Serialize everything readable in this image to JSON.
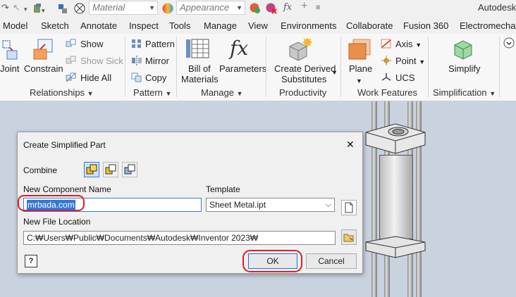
{
  "app": {
    "name": "Autodesk"
  },
  "quick_access": {
    "material_value": "Material",
    "appearance_value": "Appearance"
  },
  "tabs": [
    "Model",
    "Sketch",
    "Annotate",
    "Inspect",
    "Tools",
    "Manage",
    "View",
    "Environments",
    "Collaborate",
    "Fusion 360",
    "Electromechan"
  ],
  "ribbon": {
    "relationships": {
      "joint": "Joint",
      "constrain": "Constrain",
      "show": "Show",
      "show_sick": "Show Sick",
      "hide_all": "Hide All",
      "group": "Relationships"
    },
    "pattern": {
      "pattern": "Pattern",
      "mirror": "Mirror",
      "copy": "Copy",
      "group": "Pattern"
    },
    "manage": {
      "bom_line1": "Bill of",
      "bom_line2": "Materials",
      "parameters": "Parameters",
      "group": "Manage"
    },
    "productivity": {
      "line1": "Create Derived",
      "line2": "Substitutes",
      "group": "Productivity"
    },
    "work_features": {
      "plane": "Plane",
      "axis": "Axis",
      "point": "Point",
      "ucs": "UCS",
      "group": "Work Features"
    },
    "simplification": {
      "simplify": "Simplify",
      "group": "Simplification"
    }
  },
  "dialog": {
    "title": "Create Simplified Part",
    "combine_label": "Combine",
    "component_name_label": "New Component Name",
    "component_name_value": "mrbada.com",
    "template_label": "Template",
    "template_value": "Sheet Metal.ipt",
    "file_location_label": "New File Location",
    "file_location_value": "C:₩Users₩Public₩Documents₩Autodesk₩Inventor 2023₩",
    "ok": "OK",
    "cancel": "Cancel",
    "help": "?",
    "close": "✕"
  }
}
